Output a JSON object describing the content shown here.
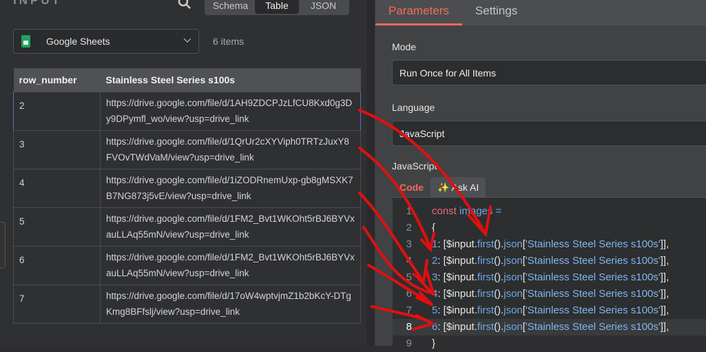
{
  "input_panel": {
    "title": "INPUT",
    "view_tabs": [
      "Schema",
      "Table",
      "JSON"
    ],
    "active_view": "Table",
    "source_select": {
      "value": "Google Sheets",
      "icon": "google-sheets-icon"
    },
    "item_count": "6 items",
    "table": {
      "columns": [
        "row_number",
        "Stainless Steel Series s100s"
      ],
      "rows": [
        [
          "2",
          "https://drive.google.com/file/d/1AH9ZDCPJzLfCU8Kxd0g3Dy9DPymfl_wo/view?usp=drive_link"
        ],
        [
          "3",
          "https://drive.google.com/file/d/1QrUr2cXYViph0TRTzJuxY8FVOvTWdVaM/view?usp=drive_link"
        ],
        [
          "4",
          "https://drive.google.com/file/d/1iZODRnemUxp-gb8gMSXK7B7NG873j5vE/view?usp=drive_link"
        ],
        [
          "5",
          "https://drive.google.com/file/d/1FM2_Bvt1WKOht5rBJ6BYVxauLLAq55mN/view?usp=drive_link"
        ],
        [
          "6",
          "https://drive.google.com/file/d/1FM2_Bvt1WKOht5rBJ6BYVxauLLAq55mN/view?usp=drive_link"
        ],
        [
          "7",
          "https://drive.google.com/file/d/17oW4wptvjmZ1b2bKcY-DTgKmg8BFfslj/view?usp=drive_link"
        ]
      ]
    }
  },
  "params_panel": {
    "tabs": [
      "Parameters",
      "Settings"
    ],
    "active_tab": "Parameters",
    "mode_label": "Mode",
    "mode_value": "Run Once for All Items",
    "language_label": "Language",
    "language_value": "JavaScript",
    "code_label": "JavaScript",
    "code_tabs": [
      "Code",
      "Ask AI"
    ],
    "code_lines": [
      {
        "n": "1",
        "parts": [
          [
            "kw",
            "const "
          ],
          [
            "bl",
            "images ="
          ]
        ]
      },
      {
        "n": "2",
        "parts": [
          [
            "wt",
            "{"
          ]
        ]
      },
      {
        "n": "3",
        "parts": [
          [
            "bl",
            "1"
          ],
          [
            "wt",
            ": [$input."
          ],
          [
            "bl",
            "first"
          ],
          [
            "wt",
            "()."
          ],
          [
            "bl",
            "json"
          ],
          [
            "wt",
            "["
          ],
          [
            "sl",
            "'Stainless Steel Series s100s'"
          ],
          [
            "wt",
            "]],"
          ]
        ]
      },
      {
        "n": "4",
        "parts": [
          [
            "bl",
            "2"
          ],
          [
            "wt",
            ": [$input."
          ],
          [
            "bl",
            "first"
          ],
          [
            "wt",
            "()."
          ],
          [
            "bl",
            "json"
          ],
          [
            "wt",
            "["
          ],
          [
            "sl",
            "'Stainless Steel Series s100s'"
          ],
          [
            "wt",
            "]],"
          ]
        ]
      },
      {
        "n": "5",
        "parts": [
          [
            "bl",
            "3"
          ],
          [
            "wt",
            ": [$input."
          ],
          [
            "bl",
            "first"
          ],
          [
            "wt",
            "()."
          ],
          [
            "bl",
            "json"
          ],
          [
            "wt",
            "["
          ],
          [
            "sl",
            "'Stainless Steel Series s100s'"
          ],
          [
            "wt",
            "]],"
          ]
        ]
      },
      {
        "n": "6",
        "parts": [
          [
            "bl",
            "4"
          ],
          [
            "wt",
            ": [$input."
          ],
          [
            "bl",
            "first"
          ],
          [
            "wt",
            "()."
          ],
          [
            "bl",
            "json"
          ],
          [
            "wt",
            "["
          ],
          [
            "sl",
            "'Stainless Steel Series s100s'"
          ],
          [
            "wt",
            "]],"
          ]
        ]
      },
      {
        "n": "7",
        "parts": [
          [
            "bl",
            "5"
          ],
          [
            "wt",
            ": [$input."
          ],
          [
            "bl",
            "first"
          ],
          [
            "wt",
            "()."
          ],
          [
            "bl",
            "json"
          ],
          [
            "wt",
            "["
          ],
          [
            "sl",
            "'Stainless Steel Series s100s'"
          ],
          [
            "wt",
            "]],"
          ]
        ]
      },
      {
        "n": "8",
        "parts": [
          [
            "bl",
            "6"
          ],
          [
            "wt",
            ": [$input."
          ],
          [
            "bl",
            "first"
          ],
          [
            "wt",
            "()."
          ],
          [
            "bl",
            "json"
          ],
          [
            "wt",
            "["
          ],
          [
            "sl",
            "'Stainless Steel Series s100s'"
          ],
          [
            "wt",
            "]],"
          ]
        ]
      },
      {
        "n": "9",
        "parts": [
          [
            "wt",
            "}"
          ]
        ]
      }
    ],
    "active_line": "8"
  },
  "colors": {
    "accent": "#f26b5b",
    "annotation": "#e01010",
    "selection": "#6b5fd6"
  }
}
